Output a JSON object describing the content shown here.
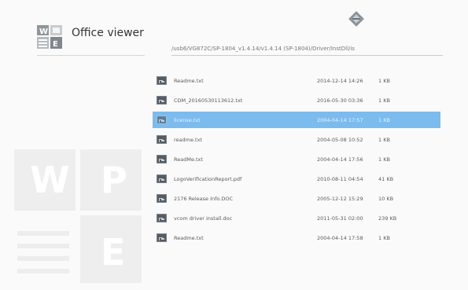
{
  "app": {
    "title": "Office viewer"
  },
  "path": "/usb6/VG872C/SP-1804_v1.4.14/v1.4.14 (SP-1804)/Driver/InstDll/is",
  "colors": {
    "selection": "#7cbbee",
    "background": "#fafafa"
  },
  "icons": {
    "app_logo": "office-viewer-logo-icon",
    "file": "document-file-icon",
    "badge": "diamond-badge-icon"
  },
  "watermark": {
    "letters": [
      "W",
      "P",
      "E"
    ]
  },
  "files": [
    {
      "name": "Readme.txt",
      "date": "2014-12-14 14:26",
      "size": "1 KB",
      "selected": false
    },
    {
      "name": "CDM_20160530113612.txt",
      "date": "2016-05-30 03:36",
      "size": "1 KB",
      "selected": false
    },
    {
      "name": "license.txt",
      "date": "2004-04-14 17:57",
      "size": "1 KB",
      "selected": true
    },
    {
      "name": "readme.txt",
      "date": "2004-05-08 10:52",
      "size": "1 KB",
      "selected": false
    },
    {
      "name": "ReadMe.txt",
      "date": "2004-04-14 17:56",
      "size": "1 KB",
      "selected": false
    },
    {
      "name": "LogoVerificationReport.pdf",
      "date": "2010-08-11 04:54",
      "size": "41 KB",
      "selected": false
    },
    {
      "name": "2176 Release Info.DOC",
      "date": "2005-12-12 15:29",
      "size": "10 KB",
      "selected": false
    },
    {
      "name": "vcom driver install.doc",
      "date": "2011-05-31 02:00",
      "size": "239 KB",
      "selected": false
    },
    {
      "name": "Readme.txt",
      "date": "2004-04-14 17:58",
      "size": "1 KB",
      "selected": false
    }
  ]
}
